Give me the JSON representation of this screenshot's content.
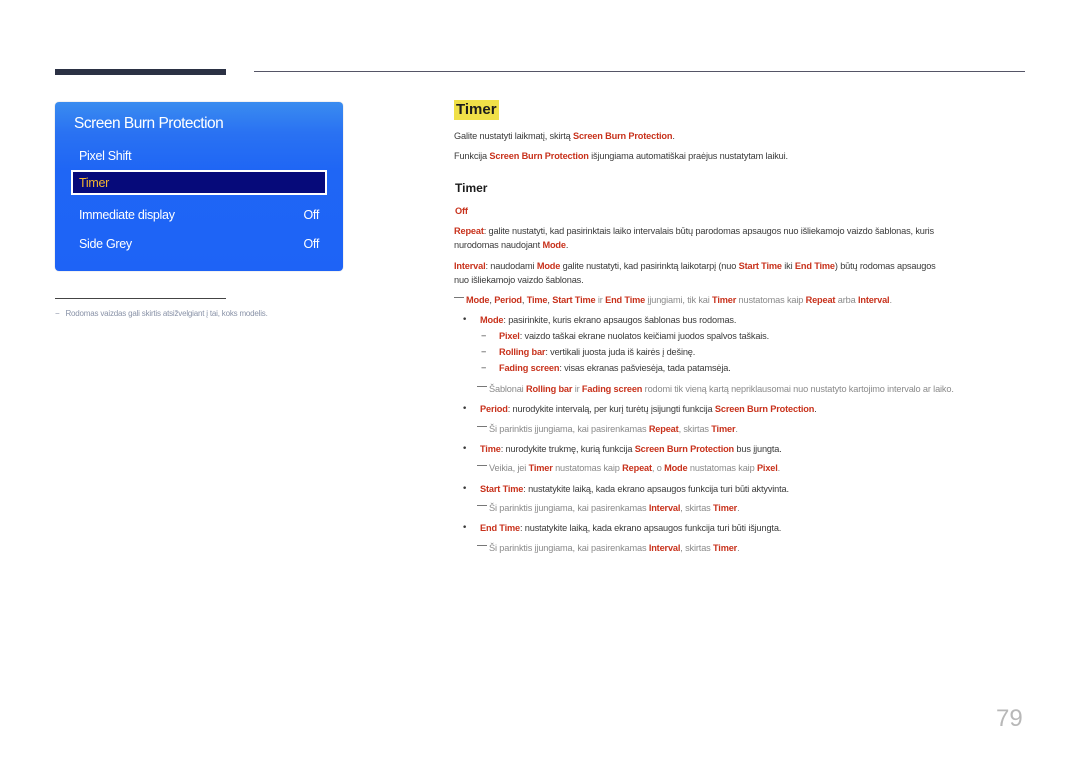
{
  "osd_menu": {
    "title": "Screen Burn Protection",
    "items": [
      {
        "label": "Pixel Shift",
        "value": ""
      },
      {
        "label": "Timer",
        "value": "",
        "selected": true
      },
      {
        "label": "Immediate display",
        "value": "Off"
      },
      {
        "label": "Side Grey",
        "value": "Off"
      }
    ]
  },
  "footnote": {
    "dash": "−",
    "text": "Rodomas vaizdas gali skirtis atsižvelgiant į tai, koks modelis."
  },
  "section": {
    "title": "Timer",
    "intro1": {
      "pre": "Galite nustatyti laikmatį, skirtą ",
      "b": "Screen Burn Protection",
      "post": "."
    },
    "intro2": {
      "pre": "Funkcija ",
      "b": "Screen Burn Protection",
      "post": " išjungiama automatiškai praėjus nustatytam laikui."
    },
    "subtitle": "Timer",
    "off_label": "Off",
    "repeat": {
      "b1": "Repeat",
      "t1": ": galite nustatyti, kad pasirinktais laiko intervalais būtų parodomas apsaugos nuo išliekamojo vaizdo šablonas, kuris",
      "t2": "nurodomas naudojant ",
      "b2": "Mode",
      "t3": "."
    },
    "interval": {
      "b1": "Interval",
      "t1": ": naudodami ",
      "b2": "Mode",
      "t2": " galite nustatyti, kad pasirinktą laikotarpį (nuo ",
      "b3": "Start Time",
      "t3": " iki ",
      "b4": "End Time",
      "t4": ") būtų rodomas apsaugos",
      "t5": "nuo išliekamojo vaizdo šablonas."
    },
    "note_enable": {
      "b1": "Mode",
      "s1": ", ",
      "b2": "Period",
      "s2": ", ",
      "b3": "Time",
      "s3": ", ",
      "b4": "Start Time",
      "t1": " ir ",
      "b5": "End Time",
      "t2": " įjungiami, tik kai ",
      "b6": "Timer",
      "t3": " nustatomas kaip ",
      "b7": "Repeat",
      "t4": " arba ",
      "b8": "Interval",
      "t5": "."
    },
    "mode": {
      "b": "Mode",
      "t": ": pasirinkite, kuris ekrano apsaugos šablonas bus rodomas."
    },
    "mode_options": [
      {
        "dash": "−",
        "b": "Pixel",
        "t": ": vaizdo taškai ekrane nuolatos keičiami juodos spalvos taškais."
      },
      {
        "dash": "−",
        "b": "Rolling bar",
        "t": ": vertikali juosta juda iš kairės į dešinę."
      },
      {
        "dash": "−",
        "b": "Fading screen",
        "t": ": visas ekranas pašviesėja, tada patamsėja."
      }
    ],
    "note_patterns": {
      "t1": "Šablonai ",
      "b1": "Rolling bar",
      "t2": " ir ",
      "b2": "Fading screen",
      "t3": " rodomi tik vieną kartą nepriklausomai nuo nustatyto kartojimo intervalo ar laiko."
    },
    "period": {
      "b1": "Period",
      "t1": ": nurodykite intervalą, per kurį turėtų įsijungti funkcija ",
      "b2": "Screen Burn Protection",
      "t2": "."
    },
    "note_period": {
      "t1": "Ši parinktis įjungiama, kai pasirenkamas ",
      "b1": "Repeat",
      "t2": ", skirtas ",
      "b2": "Timer",
      "t3": "."
    },
    "time": {
      "b1": "Time",
      "t1": ": nurodykite trukmę, kurią funkcija ",
      "b2": "Screen Burn Protection",
      "t2": " bus įjungta."
    },
    "note_time": {
      "t1": "Veikia, jei ",
      "b1": "Timer",
      "t2": " nustatomas kaip ",
      "b2": "Repeat",
      "t3": ", o ",
      "b3": "Mode",
      "t4": " nustatomas kaip ",
      "b4": "Pixel",
      "t5": "."
    },
    "start_time": {
      "b": "Start Time",
      "t": ": nustatykite laiką, kada ekrano apsaugos funkcija turi būti aktyvinta."
    },
    "note_start": {
      "t1": "Ši parinktis įjungiama, kai pasirenkamas ",
      "b1": "Interval",
      "t2": ", skirtas ",
      "b2": "Timer",
      "t3": "."
    },
    "end_time": {
      "b": "End Time",
      "t": ": nustatykite laiką, kada ekrano apsaugos funkcija turi būti išjungta."
    },
    "note_end": {
      "t1": "Ši parinktis įjungiama, kai pasirenkamas ",
      "b1": "Interval",
      "t2": ", skirtas ",
      "b2": "Timer",
      "t3": "."
    },
    "bullet_glyph": "•"
  },
  "page_number": "79",
  "colors": {
    "accent": "#c8321c",
    "osd_blue": "#1e63f6",
    "osd_selected": "#060a7a",
    "osd_selected_text": "#f3b531",
    "title_highlight": "#f0e048"
  }
}
